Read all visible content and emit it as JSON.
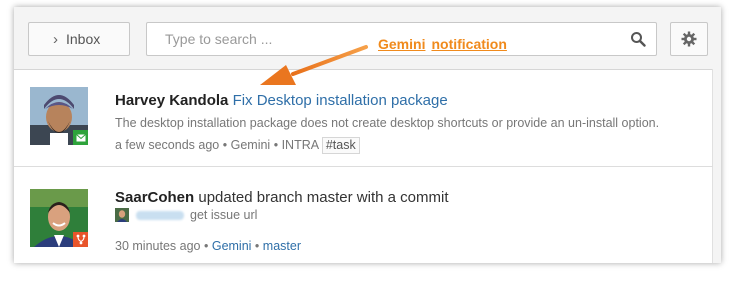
{
  "header": {
    "inbox_label": "Inbox",
    "search_placeholder": "Type to search ...",
    "search_value": ""
  },
  "annotation": {
    "word1": "Gemini",
    "word2": "notification",
    "color": "#f08a1c"
  },
  "notifications": [
    {
      "user": "Harvey Kandola",
      "action": "",
      "link_text": "Fix Desktop installation package",
      "description": "The desktop installation package does not create desktop shortcuts or provide an un-install option.",
      "time": "a few seconds ago",
      "source": "Gemini",
      "project": "INTRA",
      "tag": "#task",
      "badge_icon": "envelope-icon",
      "badge_color": "#2ea33b"
    },
    {
      "user": "SaarCohen",
      "action": "updated branch master with a commit",
      "sub_text": "get issue url",
      "time": "30 minutes ago",
      "source": "Gemini",
      "branch": "master",
      "badge_icon": "git-branch-icon",
      "badge_color": "#e8552b"
    }
  ],
  "colors": {
    "link": "#2f6fa8",
    "muted": "#777777"
  }
}
